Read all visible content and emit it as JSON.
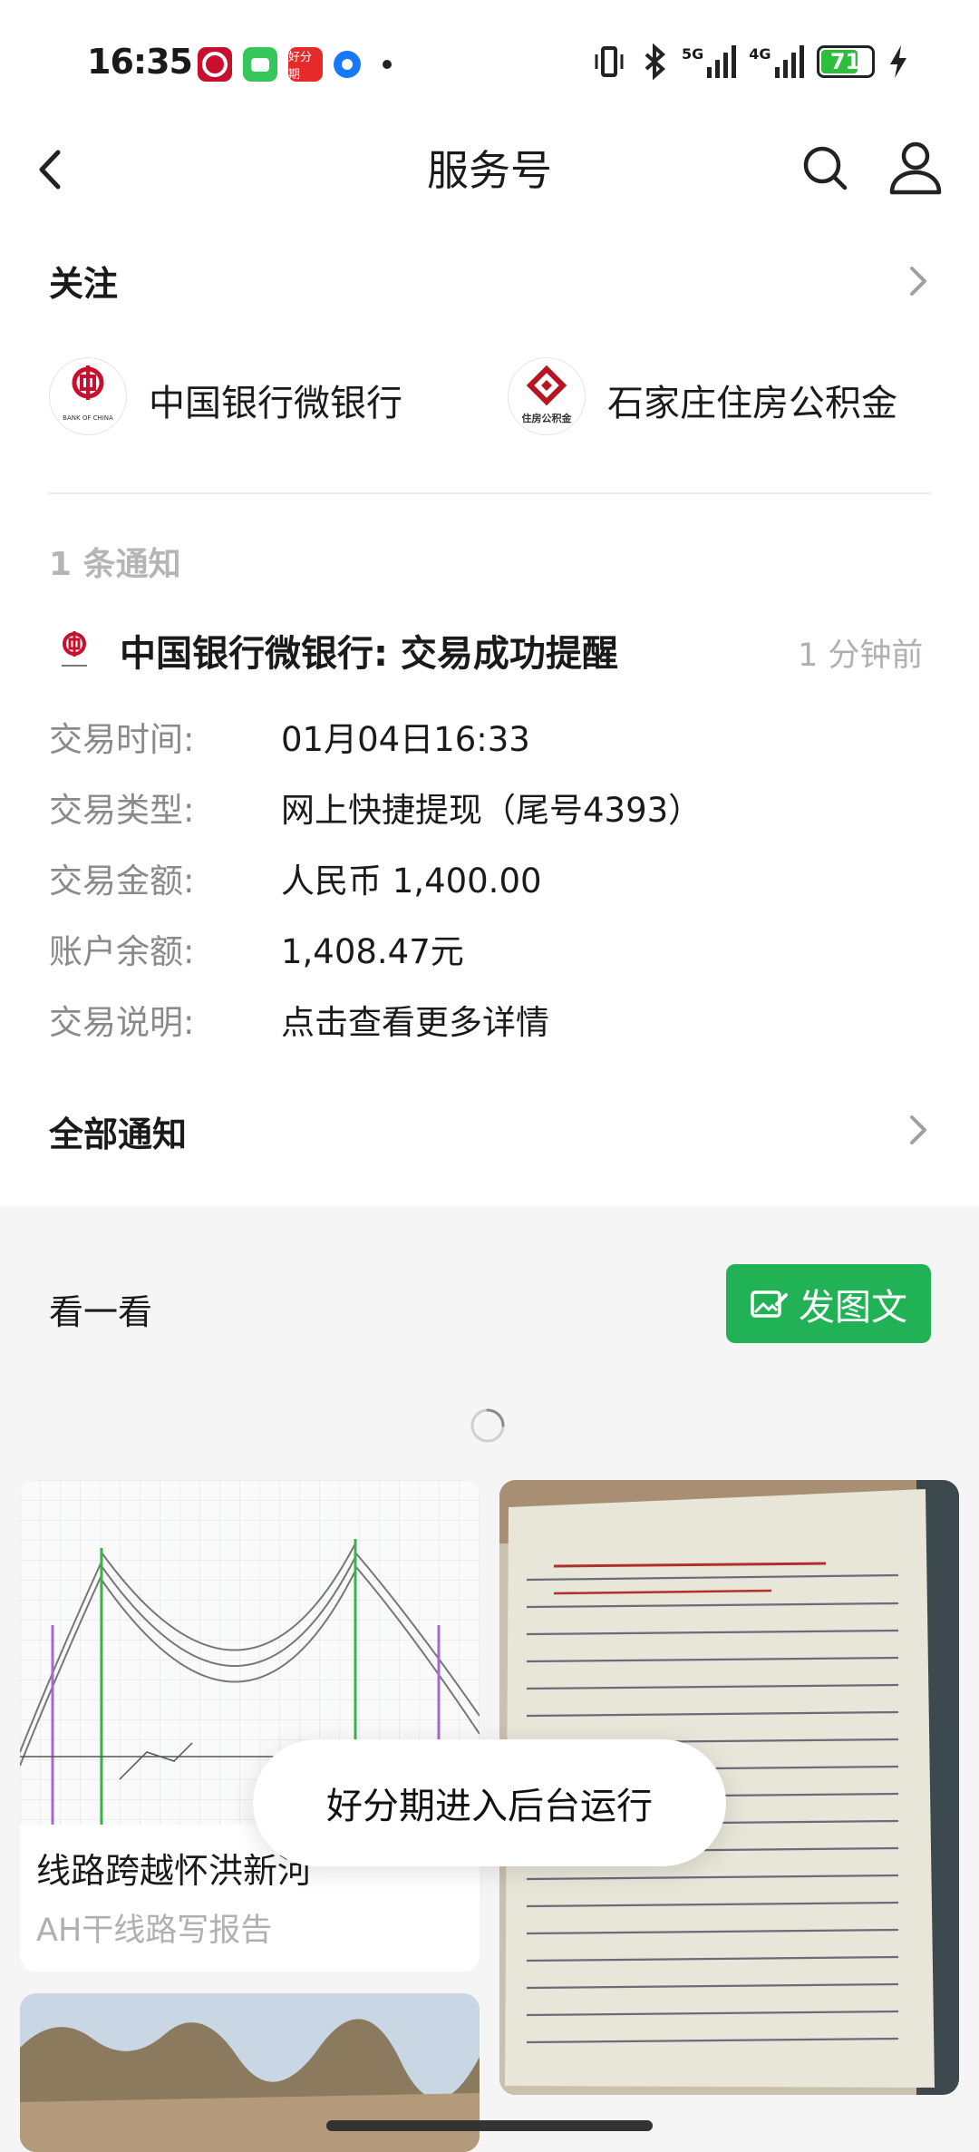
{
  "status_bar": {
    "time": "16:35",
    "battery": "71",
    "network_5g": "5G",
    "network_4g": "4G",
    "colors": {
      "battery_fill": "#2dbe3c"
    },
    "app_icons": [
      "bank-app-icon",
      "messages-icon",
      "haofenqi-icon",
      "browser-icon"
    ],
    "haofenqi_label": "好分期"
  },
  "header": {
    "title": "服务号"
  },
  "follow": {
    "label": "关注",
    "accounts": [
      {
        "name": "中国银行微银行",
        "logo_caption": "BANK OF CHINA"
      },
      {
        "name": "石家庄住房公积金",
        "logo_caption": "住房公积金"
      }
    ]
  },
  "notices": {
    "count_label": "1 条通知",
    "item": {
      "title": "中国银行微银行: 交易成功提醒",
      "time": "1 分钟前",
      "rows": [
        {
          "label": "交易时间:",
          "value": "01月04日16:33"
        },
        {
          "label": "交易类型:",
          "value": "网上快捷提现（尾号4393）"
        },
        {
          "label": "交易金额:",
          "value": "人民币 1,400.00"
        },
        {
          "label": "账户余额:",
          "value": "1,408.47元"
        },
        {
          "label": "交易说明:",
          "value": "点击查看更多详情"
        }
      ]
    },
    "all_label": "全部通知"
  },
  "feed": {
    "label": "看一看",
    "post_button": "发图文",
    "cards": [
      {
        "title": "线路跨越怀洪新河",
        "source": "AH干线路写报告"
      }
    ]
  },
  "toast": "好分期进入后台运行",
  "colors": {
    "accent": "#22b256",
    "bank_red": "#c8102e"
  }
}
